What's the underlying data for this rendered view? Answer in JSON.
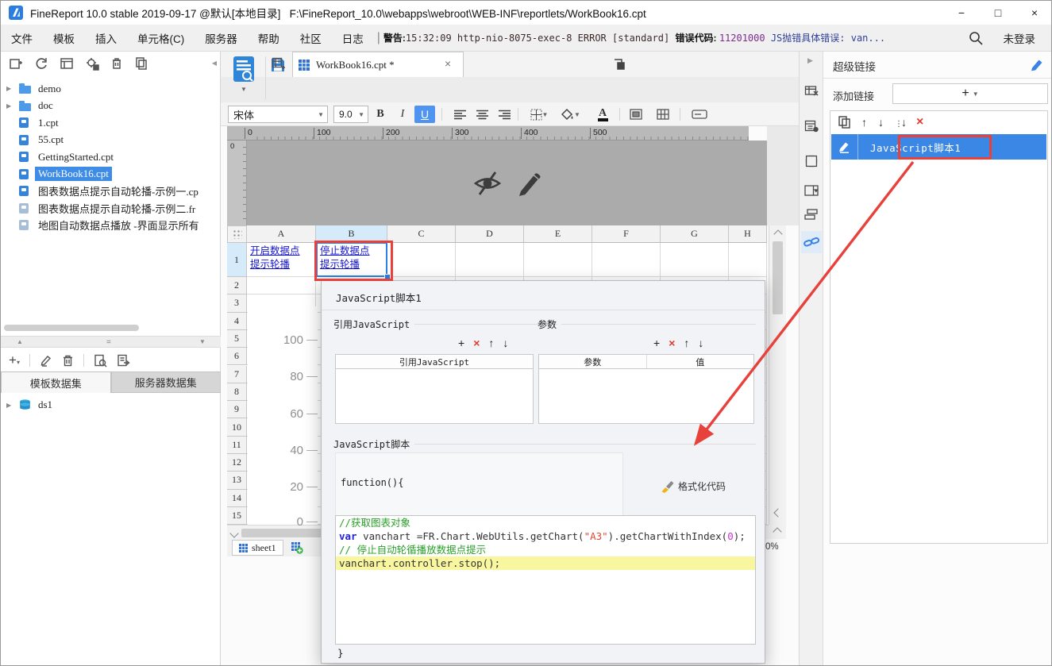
{
  "window": {
    "title": "FineReport 10.0 stable 2019-09-17 @默认[本地目录]   F:\\FineReport_10.0\\webapps\\webroot\\WEB-INF\\reportlets/WorkBook16.cpt",
    "controls": {
      "minimize": "−",
      "maximize": "□",
      "close": "×"
    }
  },
  "menubar": {
    "items": [
      "文件",
      "模板",
      "插入",
      "单元格(C)",
      "服务器",
      "帮助",
      "社区",
      "日志"
    ],
    "separator": "|",
    "log_segments": [
      {
        "text": "警告:",
        "style": "label"
      },
      {
        "text": "15:32:09 http-nio-8075-exec-8 ERROR [standard] ",
        "style": "plain"
      },
      {
        "text": "错误代码: ",
        "style": "label"
      },
      {
        "text": "11201000",
        "style": "number"
      },
      {
        "text": " JS抛错具体错误: van...",
        "style": "plain2"
      }
    ],
    "login": "未登录"
  },
  "file_panel": {
    "tree": [
      {
        "label": "demo",
        "type": "folder"
      },
      {
        "label": "doc",
        "type": "folder"
      },
      {
        "label": "1.cpt",
        "type": "cpt"
      },
      {
        "label": "55.cpt",
        "type": "cpt"
      },
      {
        "label": "GettingStarted.cpt",
        "type": "cpt"
      },
      {
        "label": "WorkBook16.cpt",
        "type": "cpt",
        "selected": true
      },
      {
        "label": "图表数据点提示自动轮播-示例一.cp",
        "type": "cpt"
      },
      {
        "label": "图表数据点提示自动轮播-示例二.fr",
        "type": "frm"
      },
      {
        "label": "地图自动数据点播放 -界面显示所有",
        "type": "frm"
      }
    ],
    "dataset_tabs": [
      {
        "label": "模板数据集",
        "active": true
      },
      {
        "label": "服务器数据集",
        "active": false
      }
    ],
    "datasets": [
      "ds1"
    ]
  },
  "main": {
    "doc_tab": "WorkBook16.cpt *",
    "font_name": "宋体",
    "font_size": "9.0",
    "bold": "B",
    "italic": "I",
    "underline": "U",
    "ruler_labels": [
      "0",
      "100",
      "200",
      "300",
      "400",
      "500"
    ],
    "vruler_label": "0",
    "columns": [
      "A",
      "B",
      "C",
      "D",
      "E",
      "F",
      "G",
      "H"
    ],
    "rows": [
      "1",
      "2",
      "3",
      "4",
      "5",
      "6",
      "7",
      "8",
      "9",
      "10",
      "11",
      "12",
      "13",
      "14",
      "15"
    ],
    "cell_a1": "开启数据点\n提示轮播",
    "cell_b1": "停止数据点\n提示轮播",
    "chart_axis": [
      "100",
      "80",
      "60",
      "40",
      "20",
      "0"
    ],
    "sheet_tab": "sheet1",
    "zoom_text": "0%"
  },
  "right_panel": {
    "title": "超级链接",
    "add_label": "添加链接",
    "add_button": "+",
    "item_label": "JavaScript脚本1"
  },
  "dialog": {
    "title": "JavaScript脚本1",
    "ref_section": "引用JavaScript",
    "ref_table_header": "引用JavaScript",
    "param_section": "参数",
    "param_col_name": "参数",
    "param_col_value": "值",
    "script_section": "JavaScript脚本",
    "function_open": "function(){",
    "format_button": "格式化代码",
    "closing_brace": "}",
    "code_lines": [
      {
        "highlight": false,
        "segments": [
          {
            "text": "//获取图表对象",
            "c": "cm"
          }
        ]
      },
      {
        "highlight": false,
        "segments": [
          {
            "text": "var",
            "c": "kw"
          },
          {
            "text": " vanchart =FR.Chart.WebUtils.getChart(",
            "c": "pl"
          },
          {
            "text": "\"A3\"",
            "c": "str"
          },
          {
            "text": ").getChartWithIndex(",
            "c": "pl"
          },
          {
            "text": "0",
            "c": "num"
          },
          {
            "text": ");",
            "c": "pl"
          }
        ]
      },
      {
        "highlight": false,
        "segments": [
          {
            "text": "// 停止自动轮循播放数据点提示",
            "c": "cm"
          }
        ]
      },
      {
        "highlight": true,
        "segments": [
          {
            "text": "vanchart.controller.stop();",
            "c": "pl"
          }
        ]
      }
    ]
  },
  "icon_glyphs": {
    "add": "+",
    "delete": "×",
    "up": "↑",
    "down": "↓"
  }
}
